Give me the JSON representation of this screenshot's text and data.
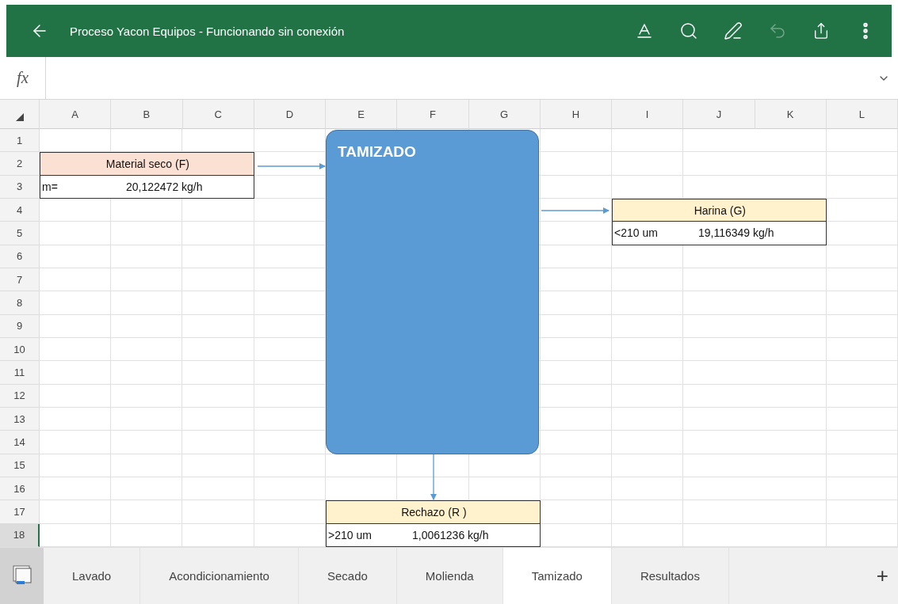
{
  "title_bar": {
    "title": "Proceso Yacon Equipos - Funcionando sin conexión",
    "undo_enabled": false
  },
  "formula_bar": {
    "fx_label": "fx"
  },
  "columns": [
    "A",
    "B",
    "C",
    "D",
    "E",
    "F",
    "G",
    "H",
    "I",
    "J",
    "K",
    "L"
  ],
  "rows": [
    {
      "label": "1",
      "selected": false
    },
    {
      "label": "2",
      "selected": false
    },
    {
      "label": "3",
      "selected": false
    },
    {
      "label": "4",
      "selected": false
    },
    {
      "label": "5",
      "selected": false
    },
    {
      "label": "6",
      "selected": false
    },
    {
      "label": "7",
      "selected": false
    },
    {
      "label": "8",
      "selected": false
    },
    {
      "label": "9",
      "selected": false
    },
    {
      "label": "10",
      "selected": false
    },
    {
      "label": "11",
      "selected": false
    },
    {
      "label": "12",
      "selected": false
    },
    {
      "label": "13",
      "selected": false
    },
    {
      "label": "14",
      "selected": false
    },
    {
      "label": "15",
      "selected": false
    },
    {
      "label": "16",
      "selected": false
    },
    {
      "label": "17",
      "selected": false
    },
    {
      "label": "18",
      "selected": true
    }
  ],
  "process": {
    "title": "TAMIZADO"
  },
  "streams": [
    {
      "title": "Material seco (F)",
      "label": "m=",
      "value": "20,122472 kg/h",
      "color": "#fbe1d4"
    },
    {
      "title": "Harina (G)",
      "label": "<210 um",
      "value": "19,116349 kg/h",
      "color": "#fff2cc"
    },
    {
      "title": "Rechazo (R )",
      "label": ">210 um",
      "value": "1,0061236 kg/h",
      "color": "#fff2cc"
    }
  ],
  "sheet_tabs": [
    {
      "label": "Lavado",
      "selected": false
    },
    {
      "label": "Acondicionamiento",
      "selected": false
    },
    {
      "label": "Secado",
      "selected": false
    },
    {
      "label": "Molienda",
      "selected": false
    },
    {
      "label": "Tamizado",
      "selected": true
    },
    {
      "label": "Resultados",
      "selected": false
    }
  ],
  "add_sheet": "+"
}
